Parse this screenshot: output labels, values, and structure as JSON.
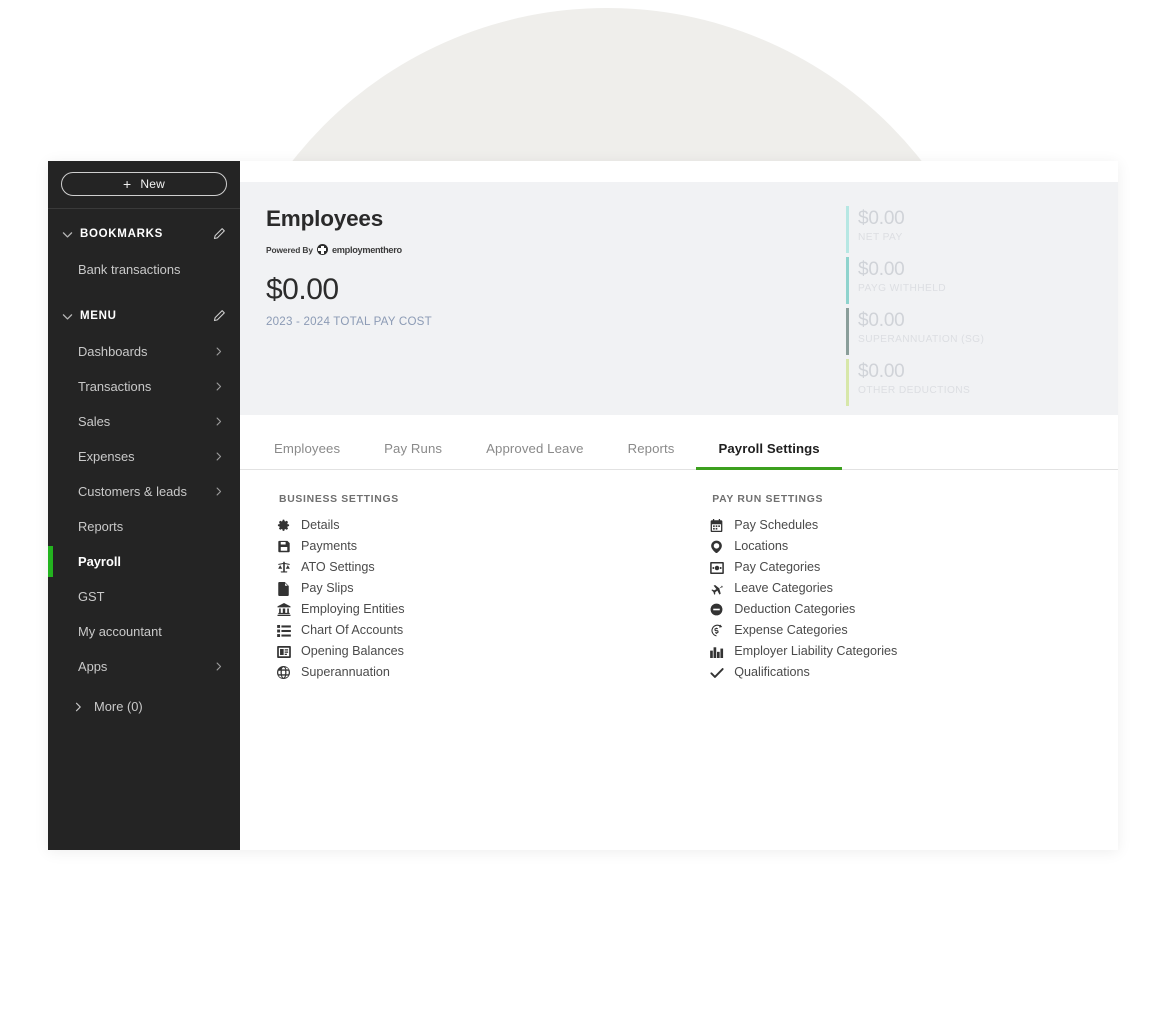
{
  "sidebar": {
    "new_button": {
      "label": "New",
      "icon": "plus-icon"
    },
    "sections": [
      {
        "label": "BOOKMARKS",
        "edit_icon": "pencil-icon",
        "items": [
          {
            "label": "Bank transactions",
            "has_arrow": false,
            "active": false
          }
        ]
      },
      {
        "label": "MENU",
        "edit_icon": "pencil-icon",
        "items": [
          {
            "label": "Dashboards",
            "has_arrow": true,
            "active": false
          },
          {
            "label": "Transactions",
            "has_arrow": true,
            "active": false
          },
          {
            "label": "Sales",
            "has_arrow": true,
            "active": false
          },
          {
            "label": "Expenses",
            "has_arrow": true,
            "active": false
          },
          {
            "label": "Customers & leads",
            "has_arrow": true,
            "active": false
          },
          {
            "label": "Reports",
            "has_arrow": false,
            "active": false
          },
          {
            "label": "Payroll",
            "has_arrow": false,
            "active": true
          },
          {
            "label": "GST",
            "has_arrow": false,
            "active": false
          },
          {
            "label": "My accountant",
            "has_arrow": false,
            "active": false
          },
          {
            "label": "Apps",
            "has_arrow": true,
            "active": false
          }
        ]
      }
    ],
    "more_label": "More (0)",
    "active_accent_color": "#23b31f"
  },
  "header": {
    "title": "Employees",
    "powered_by_prefix": "Powered By",
    "powered_by_brand": "employmenthero",
    "total_amount": "$0.00",
    "total_caption": "2023 - 2024 TOTAL PAY COST",
    "stats": [
      {
        "value": "$0.00",
        "label": "NET PAY",
        "color": "#b6e7e3"
      },
      {
        "value": "$0.00",
        "label": "PAYG WITHHELD",
        "color": "#8ed3cd"
      },
      {
        "value": "$0.00",
        "label": "SUPERANNUATION (SG)",
        "color": "#8a9e9a"
      },
      {
        "value": "$0.00",
        "label": "OTHER DEDUCTIONS",
        "color": "#d7e7a9"
      }
    ]
  },
  "tabs": {
    "accent_color": "#3ca01e",
    "items": [
      {
        "label": "Employees",
        "active": false
      },
      {
        "label": "Pay Runs",
        "active": false
      },
      {
        "label": "Approved Leave",
        "active": false
      },
      {
        "label": "Reports",
        "active": false
      },
      {
        "label": "Payroll Settings",
        "active": true
      }
    ]
  },
  "settings": {
    "business": {
      "heading": "BUSINESS SETTINGS",
      "items": [
        {
          "label": "Details",
          "icon": "gear-icon"
        },
        {
          "label": "Payments",
          "icon": "save-floppy-icon"
        },
        {
          "label": "ATO Settings",
          "icon": "balance-scales-icon"
        },
        {
          "label": "Pay Slips",
          "icon": "file-icon"
        },
        {
          "label": "Employing Entities",
          "icon": "bank-icon"
        },
        {
          "label": "Chart Of Accounts",
          "icon": "list-icon"
        },
        {
          "label": "Opening Balances",
          "icon": "id-card-icon"
        },
        {
          "label": "Superannuation",
          "icon": "globe-icon"
        }
      ]
    },
    "payrun": {
      "heading": "PAY RUN SETTINGS",
      "items": [
        {
          "label": "Pay Schedules",
          "icon": "calendar-icon"
        },
        {
          "label": "Locations",
          "icon": "location-globe-icon"
        },
        {
          "label": "Pay Categories",
          "icon": "money-card-icon"
        },
        {
          "label": "Leave Categories",
          "icon": "plane-icon"
        },
        {
          "label": "Deduction Categories",
          "icon": "minus-circle-icon"
        },
        {
          "label": "Expense Categories",
          "icon": "dollar-clock-icon"
        },
        {
          "label": "Employer Liability Categories",
          "icon": "bar-chart-icon"
        },
        {
          "label": "Qualifications",
          "icon": "check-icon"
        }
      ]
    }
  }
}
